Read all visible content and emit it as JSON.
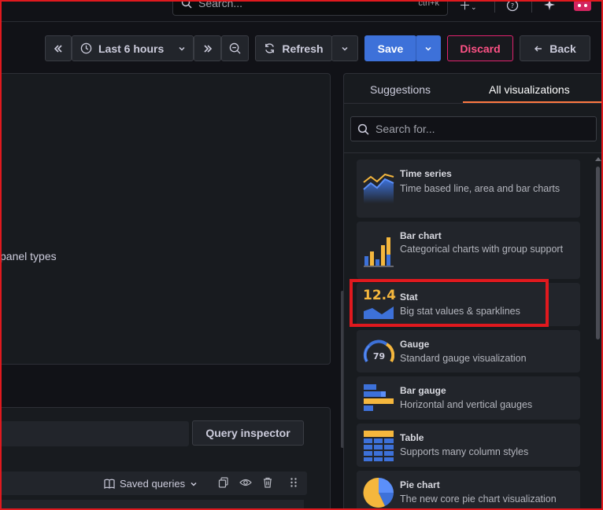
{
  "topbar": {
    "search_placeholder": "Search...",
    "search_shortcut": "ctrl+k"
  },
  "toolbar": {
    "time_range_label": "Last 6 hours",
    "refresh_label": "Refresh",
    "save_label": "Save",
    "discard_label": "Discard",
    "back_label": "Back"
  },
  "preview": {
    "hint_text": "panel types"
  },
  "query": {
    "inspector_label": "Query inspector",
    "saved_queries_label": "Saved queries"
  },
  "viz_picker": {
    "tabs": [
      {
        "label": "Suggestions"
      },
      {
        "label": "All visualizations"
      }
    ],
    "search_placeholder": "Search for...",
    "items": [
      {
        "title": "Time series",
        "description": "Time based line, area and bar charts",
        "icon": "time-series-icon"
      },
      {
        "title": "Bar chart",
        "description": "Categorical charts with group support",
        "icon": "bar-chart-icon"
      },
      {
        "title": "Stat",
        "description": "Big stat values & sparklines",
        "icon": "stat-icon",
        "icon_text": "12.4"
      },
      {
        "title": "Gauge",
        "description": "Standard gauge visualization",
        "icon": "gauge-icon",
        "icon_text": "79"
      },
      {
        "title": "Bar gauge",
        "description": "Horizontal and vertical gauges",
        "icon": "bar-gauge-icon"
      },
      {
        "title": "Table",
        "description": "Supports many column styles",
        "icon": "table-icon"
      },
      {
        "title": "Pie chart",
        "description": "The new core pie chart visualization",
        "icon": "pie-chart-icon"
      }
    ]
  },
  "colors": {
    "primary": "#3d71d9",
    "danger": "#ff5286",
    "accent_tab": "#ff7941",
    "highlight": "#e0191e"
  }
}
